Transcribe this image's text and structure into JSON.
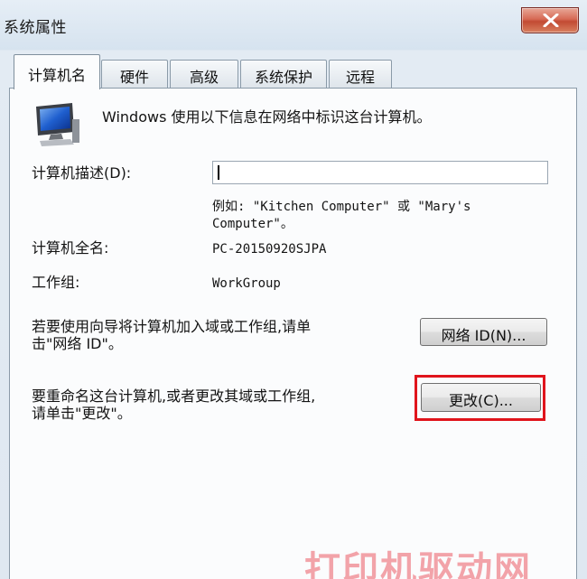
{
  "window": {
    "title": "系统属性"
  },
  "tabs": [
    {
      "label": "计算机名",
      "active": true
    },
    {
      "label": "硬件",
      "active": false
    },
    {
      "label": "高级",
      "active": false
    },
    {
      "label": "系统保护",
      "active": false
    },
    {
      "label": "远程",
      "active": false
    }
  ],
  "content": {
    "intro": "Windows 使用以下信息在网络中标识这台计算机。",
    "description_label": "计算机描述(D):",
    "description_value": "",
    "example_line1": "例如: \"Kitchen Computer\" 或 \"Mary's",
    "example_line2": "Computer\"。",
    "fullname_label": "计算机全名:",
    "fullname_value": "PC-20150920SJPA",
    "workgroup_label": "工作组:",
    "workgroup_value": "WorkGroup",
    "network_text_line1": "若要使用向导将计算机加入域或工作组,请单",
    "network_text_line2": "击\"网络 ID\"。",
    "network_button": "网络 ID(N)...",
    "rename_text_line1": "要重命名这台计算机,或者更改其域或工作组,",
    "rename_text_line2": "请单击\"更改\"。",
    "change_button": "更改(C)..."
  },
  "watermark": "打印机驱动网",
  "colors": {
    "highlight": "#e0141c",
    "close_button": "#c24a33"
  },
  "icons": [
    "close-icon",
    "computer-icon"
  ]
}
